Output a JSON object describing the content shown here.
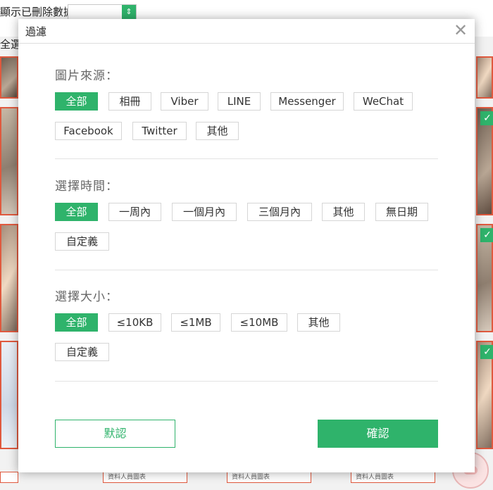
{
  "background": {
    "show_deleted_label": "顯示已刪除數據",
    "select_all_label": "全選",
    "caption_text": "資料人員圖表"
  },
  "dialog": {
    "title": "過濾",
    "close_glyph": "✕",
    "sections": {
      "source": {
        "title": "圖片來源：",
        "options": [
          "全部",
          "相冊",
          "Viber",
          "LINE",
          "Messenger",
          "WeChat",
          "Facebook",
          "Twitter",
          "其他"
        ],
        "selected": "全部"
      },
      "time": {
        "title": "選擇時間：",
        "options": [
          "全部",
          "一周內",
          "一個月內",
          "三個月內",
          "其他",
          "無日期",
          "自定義"
        ],
        "selected": "全部"
      },
      "size": {
        "title": "選擇大小：",
        "options": [
          "全部",
          "≤10KB",
          "≤1MB",
          "≤10MB",
          "其他",
          "自定義"
        ],
        "selected": "全部"
      }
    },
    "buttons": {
      "default_label": "默認",
      "confirm_label": "確認"
    }
  },
  "colors": {
    "accent": "#2fb36b",
    "thumb_border": "#e0593e"
  }
}
